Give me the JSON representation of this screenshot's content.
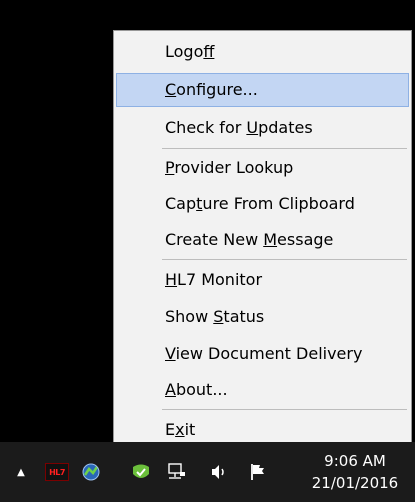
{
  "menu": {
    "items": [
      {
        "pre": "Logo",
        "key": "f",
        "post": "f"
      },
      {
        "pre": "",
        "key": "C",
        "post": "onfigure..."
      },
      {
        "pre": "Check for ",
        "key": "U",
        "post": "pdates"
      },
      {
        "pre": "",
        "key": "P",
        "post": "rovider Lookup"
      },
      {
        "pre": "Cap",
        "key": "t",
        "post": "ure From Clipboard"
      },
      {
        "pre": "Create New ",
        "key": "M",
        "post": "essage"
      },
      {
        "pre": "",
        "key": "H",
        "post": "L7 Monitor"
      },
      {
        "pre": "Show ",
        "key": "S",
        "post": "tatus"
      },
      {
        "pre": "",
        "key": "V",
        "post": "iew Document Delivery"
      },
      {
        "pre": "",
        "key": "A",
        "post": "bout..."
      },
      {
        "pre": "E",
        "key": "x",
        "post": "it"
      }
    ]
  },
  "taskbar": {
    "icons": [
      {
        "name": "show-hidden-icons",
        "glyph": "▲"
      },
      {
        "name": "hl7-tray-icon",
        "glyph": "HL7"
      },
      {
        "name": "network-app-tray-icon",
        "glyph": ""
      },
      {
        "name": "green-shield-tray-icon",
        "glyph": ""
      },
      {
        "name": "network-icon",
        "glyph": ""
      },
      {
        "name": "volume-icon",
        "glyph": ""
      },
      {
        "name": "action-center-flag-icon",
        "glyph": ""
      }
    ],
    "clock": {
      "time": "9:06 AM",
      "date": "21/01/2016"
    }
  },
  "colors": {
    "menu_bg": "#f2f2f2",
    "highlight_bg": "#c3d6f3",
    "highlight_border": "#8eb1e4",
    "taskbar_bg": "#1b1b1b"
  }
}
